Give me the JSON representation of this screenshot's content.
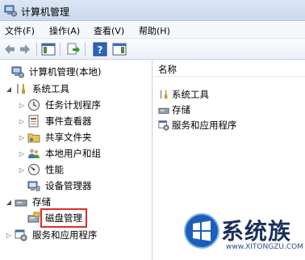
{
  "window": {
    "title": "计算机管理"
  },
  "menu": [
    {
      "label": "文件(F)"
    },
    {
      "label": "操作(A)"
    },
    {
      "label": "查看(V)"
    },
    {
      "label": "帮助(H)"
    }
  ],
  "toolbar": {
    "buttons": [
      {
        "icon": "back-arrow-icon"
      },
      {
        "icon": "forward-arrow-icon"
      },
      {
        "icon": "show-hide-tree-icon"
      },
      {
        "icon": "export-list-icon"
      },
      {
        "icon": "help-icon"
      },
      {
        "icon": "action-pane-icon"
      }
    ]
  },
  "tree": {
    "root": "计算机管理(本地)",
    "system_tools": "系统工具",
    "task_scheduler": "任务计划程序",
    "event_viewer": "事件查看器",
    "shared_folders": "共享文件夹",
    "local_users": "本地用户和组",
    "performance": "性能",
    "device_manager": "设备管理器",
    "storage": "存储",
    "disk_management": "磁盘管理",
    "services_apps": "服务和应用程序"
  },
  "list": {
    "column_name": "名称",
    "items": [
      {
        "label": "系统工具",
        "icon": "tools-icon"
      },
      {
        "label": "存储",
        "icon": "storage-icon"
      },
      {
        "label": "服务和应用程序",
        "icon": "services-icon"
      }
    ]
  },
  "watermark": {
    "text": "系统族",
    "url": "www.XITONGZU.COM"
  },
  "colors": {
    "highlight_box": "#e02c2c",
    "titlebar": "#dce7f5"
  }
}
